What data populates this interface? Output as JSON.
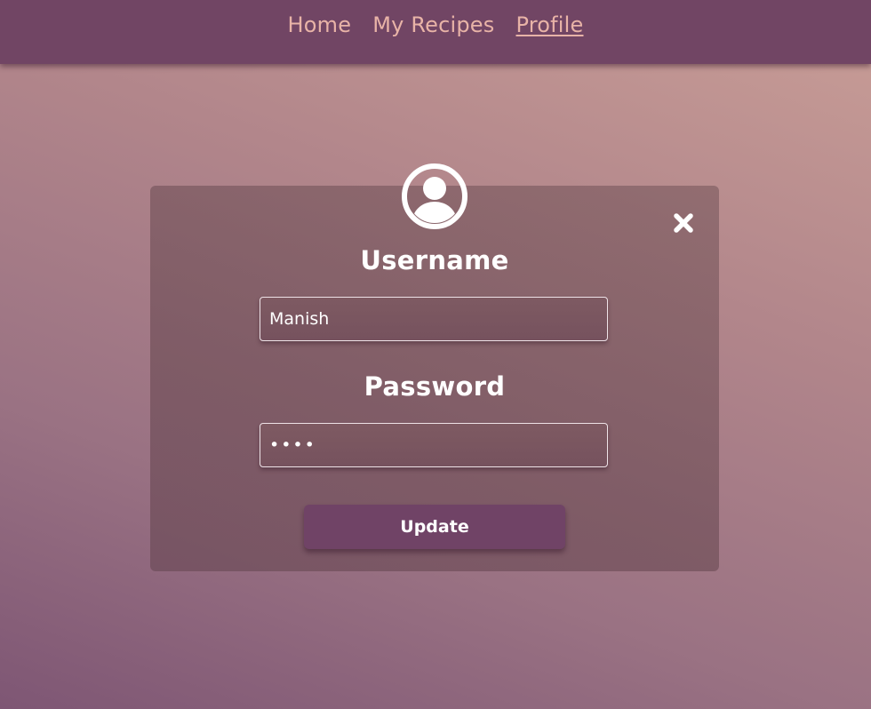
{
  "nav": {
    "items": [
      {
        "label": "Home",
        "active": false
      },
      {
        "label": "My Recipes",
        "active": false
      },
      {
        "label": "Profile",
        "active": true
      }
    ]
  },
  "profile_card": {
    "avatar_icon": "user-circle-icon",
    "close_icon": "close-x-icon",
    "username_label": "Username",
    "username_value": "Manish",
    "password_label": "Password",
    "password_value": "••••",
    "update_label": "Update"
  },
  "colors": {
    "navbar": "#714564",
    "nav_link": "#e8b3a7",
    "button": "#704366",
    "text": "#ffffff"
  }
}
